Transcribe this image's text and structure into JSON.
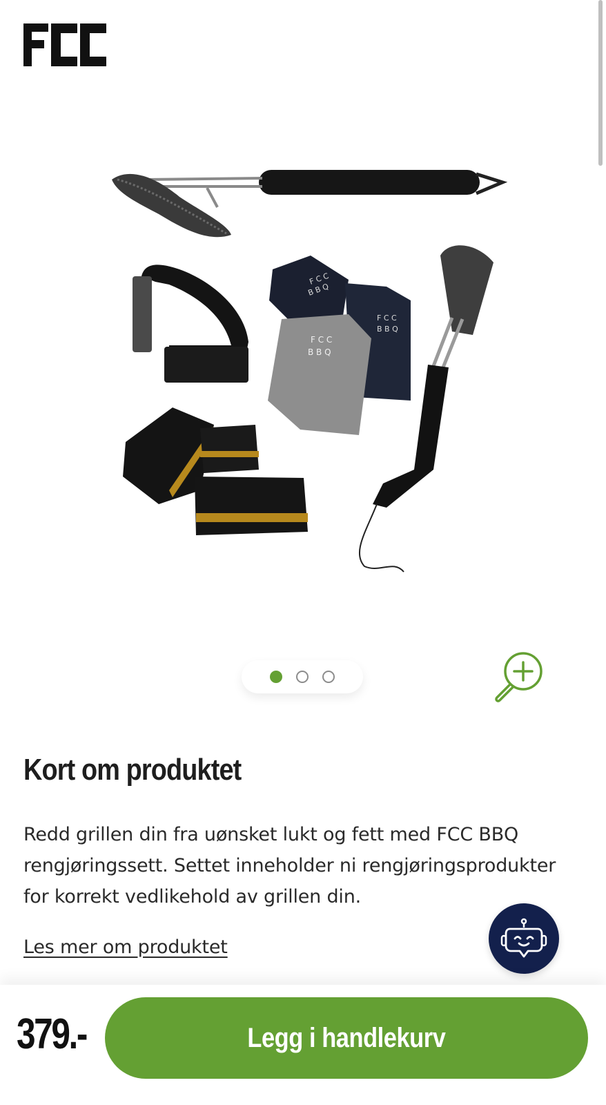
{
  "header": {
    "logo_text": "FCC"
  },
  "gallery": {
    "product_image_label": "FCC BBQ",
    "page_count": 3,
    "active_index": 0,
    "zoom_icon": "zoom-in-icon"
  },
  "about": {
    "title": "Kort om produktet",
    "description": "Redd grillen din fra uønsket lukt og fett med FCC BBQ rengjøringssett. Settet inneholder ni rengjøringsprodukter for korrekt vedlikehold av grillen din.",
    "read_more": "Les mer om produktet"
  },
  "chat": {
    "icon": "chat-robot-icon"
  },
  "purchase": {
    "price": "379.-",
    "add_to_cart": "Legg i handlekurv"
  },
  "colors": {
    "brand_green": "#64a033",
    "chat_navy": "#13204c"
  }
}
